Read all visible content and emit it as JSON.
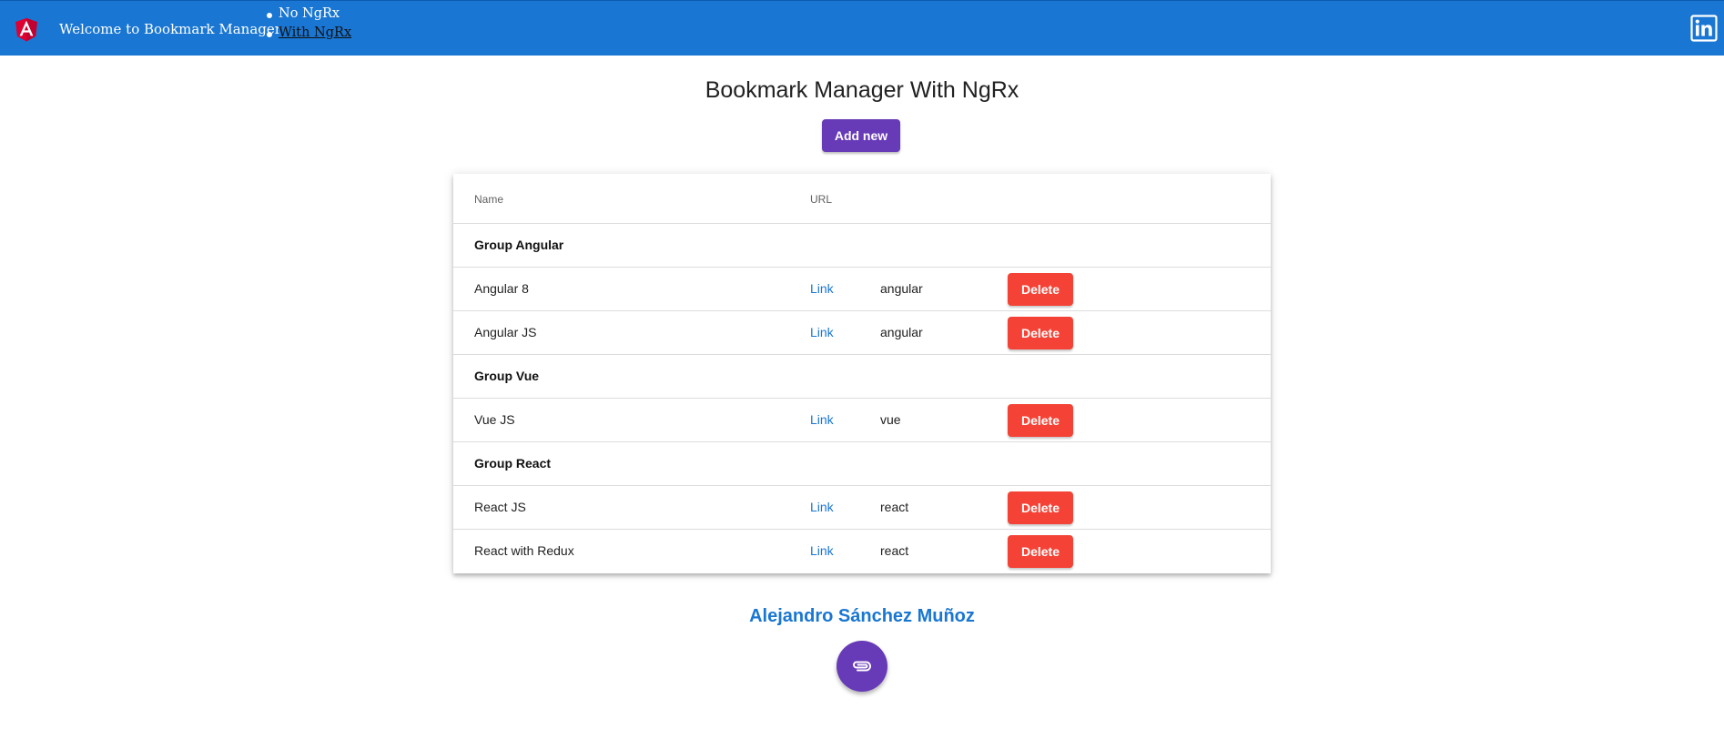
{
  "header": {
    "welcome": "Welcome to Bookmark Manager",
    "nav": [
      {
        "label": "No NgRx",
        "active": false
      },
      {
        "label": "With NgRx",
        "active": true
      }
    ],
    "logo_icon": "angular-logo-icon",
    "social_icon": "linkedin-icon",
    "color": "#1976d2"
  },
  "main": {
    "title": "Bookmark Manager With NgRx",
    "add_label": "Add new",
    "accent": "#673ab7"
  },
  "table": {
    "columns": [
      "Name",
      "URL"
    ],
    "rows": [
      {
        "type": "group",
        "name": "Group Angular"
      },
      {
        "type": "item",
        "name": "Angular 8",
        "link": "Link",
        "tag": "angular",
        "action": "Delete"
      },
      {
        "type": "item",
        "name": "Angular JS",
        "link": "Link",
        "tag": "angular",
        "action": "Delete"
      },
      {
        "type": "group",
        "name": "Group Vue"
      },
      {
        "type": "item",
        "name": "Vue JS",
        "link": "Link",
        "tag": "vue",
        "action": "Delete"
      },
      {
        "type": "group",
        "name": "Group React"
      },
      {
        "type": "item",
        "name": "React JS",
        "link": "Link",
        "tag": "react",
        "action": "Delete"
      },
      {
        "type": "item",
        "name": "React with Redux",
        "link": "Link",
        "tag": "react",
        "action": "Delete"
      }
    ],
    "delete_color": "#f44336"
  },
  "footer": {
    "author": "Alejandro Sánchez Muñoz",
    "fab_icon": "attachment-icon"
  }
}
